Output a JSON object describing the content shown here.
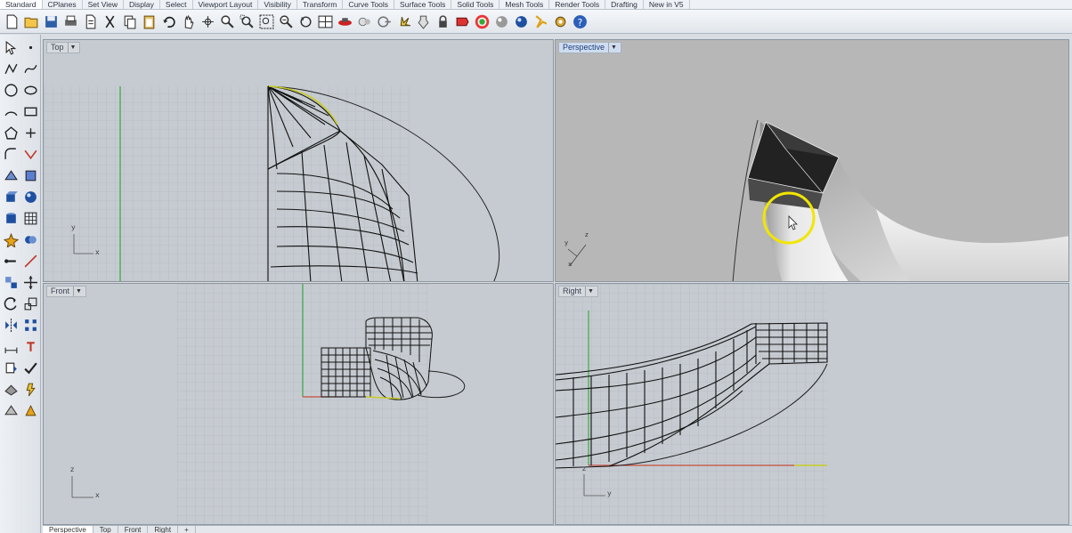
{
  "tabs": [
    "Standard",
    "CPlanes",
    "Set View",
    "Display",
    "Select",
    "Viewport Layout",
    "Visibility",
    "Transform",
    "Curve Tools",
    "Surface Tools",
    "Solid Tools",
    "Mesh Tools",
    "Render Tools",
    "Drafting",
    "New in V5"
  ],
  "active_tab": "Standard",
  "viewports": {
    "top": {
      "label": "Top"
    },
    "perspective": {
      "label": "Perspective"
    },
    "front": {
      "label": "Front"
    },
    "right": {
      "label": "Right"
    }
  },
  "axis_labels": {
    "x": "x",
    "y": "y",
    "z": "z"
  },
  "bottom_tabs": [
    "Perspective",
    "Top",
    "Front",
    "Right",
    "+"
  ],
  "active_bottom_tab": "Perspective",
  "toolbar_icons": [
    "new-icon",
    "open-icon",
    "save-icon",
    "print-icon",
    "import-icon",
    "cut-icon",
    "copy-icon",
    "paste-icon",
    "undo-icon",
    "pan-icon",
    "rotate-view-icon",
    "zoom-icon",
    "zoom-window-icon",
    "zoom-extents-icon",
    "zoom-selected-icon",
    "undo-view-icon",
    "four-viewports-icon",
    "grid-snap-icon",
    "hide-icon",
    "show-icon",
    "lock-icon",
    "layer-icon",
    "light-icon",
    "color-wheel-icon",
    "material-icon",
    "sphere-render-icon",
    "render-icon",
    "settings-icon",
    "options-icon",
    "help-icon"
  ],
  "left_tool_icons": [
    "select-arrow-icon",
    "point-icon",
    "polyline-icon",
    "curve-icon",
    "circle-icon",
    "ellipse-icon",
    "arc-icon",
    "rectangle-icon",
    "polygon-icon",
    "offset-icon",
    "fillet-curve-icon",
    "trim-curve-icon",
    "surface-icon",
    "extrude-icon",
    "box-icon",
    "sphere-icon",
    "cylinder-icon",
    "mesh-icon",
    "explode-icon",
    "boolean-icon",
    "join-icon",
    "split-icon",
    "group-icon",
    "move-icon",
    "rotate-icon",
    "scale-icon",
    "mirror-icon",
    "array-icon",
    "dimension-icon",
    "text-icon",
    "analyze-icon",
    "check-icon",
    "render-preview-icon",
    "light-bulb-icon",
    "shade-icon",
    "ghost-icon"
  ],
  "colors": {
    "accent_active": "#cfdcf0",
    "viewport_bg": "#c6cbd1",
    "perspective_bg": "#b7b7b7",
    "x_axis": "#c44b3f",
    "y_axis": "#3fa84a",
    "cursor_ring": "#f1e600"
  }
}
